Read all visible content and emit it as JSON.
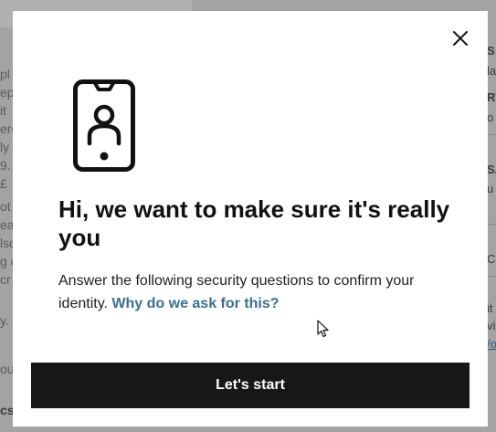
{
  "background": {
    "left_fragments": [
      "pl",
      "ep",
      "it",
      "ere",
      "ly",
      "9.",
      "£",
      "ot",
      "ea",
      "lso",
      "g c",
      "cr",
      "y.",
      "our",
      "cs"
    ],
    "right_fragments": [
      "S",
      "la",
      "RY",
      "o",
      "SA",
      "u",
      "Co",
      "it",
      "vil",
      "/o"
    ]
  },
  "modal": {
    "close_label": "Close",
    "title": "Hi, we want to make sure it's really you",
    "description": "Answer the following security questions to confirm your identity.",
    "link_text": "Why do we ask for this?",
    "primary_button": "Let's start"
  },
  "colors": {
    "link": "#3b6e8f",
    "button_bg": "#171717",
    "overlay": "#a3a3a3"
  },
  "icons": {
    "close": "close-icon",
    "illustration": "phone-user-icon",
    "cursor": "mouse-cursor-icon"
  }
}
